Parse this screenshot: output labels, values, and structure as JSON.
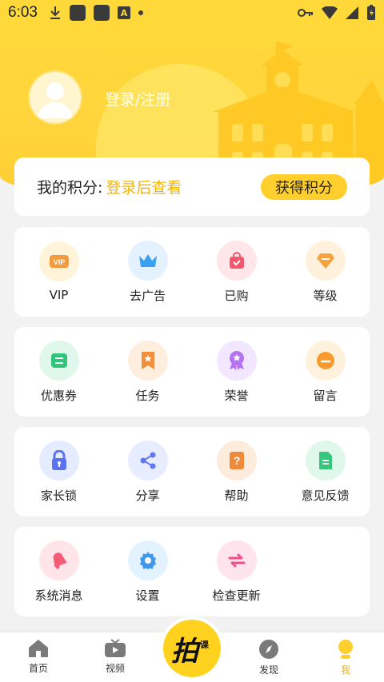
{
  "status_bar": {
    "time": "6:03",
    "a_badge": "A"
  },
  "profile": {
    "login_text": "登录/注册"
  },
  "points": {
    "label": "我的积分:",
    "value": "登录后查看",
    "button": "获得积分"
  },
  "sections": [
    {
      "items": [
        {
          "label": "VIP",
          "icon": "vip-icon",
          "bg": "#fff3d9",
          "color": "#f39a3e"
        },
        {
          "label": "去广告",
          "icon": "crown-icon",
          "bg": "#e4f1ff",
          "color": "#3aa0f2"
        },
        {
          "label": "已购",
          "icon": "shopping-bag-icon",
          "bg": "#ffe6ea",
          "color": "#f2576d"
        },
        {
          "label": "等级",
          "icon": "diamond-icon",
          "bg": "#fff1dc",
          "color": "#f7a23e"
        }
      ]
    },
    {
      "items": [
        {
          "label": "优惠券",
          "icon": "coupon-icon",
          "bg": "#e0f8ec",
          "color": "#2fc57a"
        },
        {
          "label": "任务",
          "icon": "bookmark-icon",
          "bg": "#fdeedd",
          "color": "#f08f3c"
        },
        {
          "label": "荣誉",
          "icon": "medal-icon",
          "bg": "#f3e6ff",
          "color": "#b572f2"
        },
        {
          "label": "留言",
          "icon": "message-icon",
          "bg": "#fff2dd",
          "color": "#f79b2e"
        }
      ]
    },
    {
      "items": [
        {
          "label": "家长锁",
          "icon": "lock-icon",
          "bg": "#e6ecff",
          "color": "#5b73ef"
        },
        {
          "label": "分享",
          "icon": "share-icon",
          "bg": "#e8ecff",
          "color": "#6177ef"
        },
        {
          "label": "帮助",
          "icon": "help-book-icon",
          "bg": "#fdebdc",
          "color": "#f08a3b"
        },
        {
          "label": "意见反馈",
          "icon": "feedback-doc-icon",
          "bg": "#e0f8ec",
          "color": "#36c77d"
        }
      ]
    },
    {
      "items": [
        {
          "label": "系统消息",
          "icon": "bell-icon",
          "bg": "#ffe5ea",
          "color": "#f45c76"
        },
        {
          "label": "设置",
          "icon": "gear-icon",
          "bg": "#e3f2ff",
          "color": "#3e99ee"
        },
        {
          "label": "检查更新",
          "icon": "refresh-arrows-icon",
          "bg": "#ffe4ee",
          "color": "#f2508a"
        }
      ]
    }
  ],
  "tabbar": {
    "tabs": [
      {
        "label": "首页",
        "icon": "home-icon"
      },
      {
        "label": "视频",
        "icon": "tv-icon"
      },
      {
        "label": "发现",
        "icon": "compass-icon"
      },
      {
        "label": "我",
        "icon": "person-icon"
      }
    ],
    "center_logo": "拍",
    "center_logo_small": "课程",
    "active_color": "#f5b400"
  }
}
